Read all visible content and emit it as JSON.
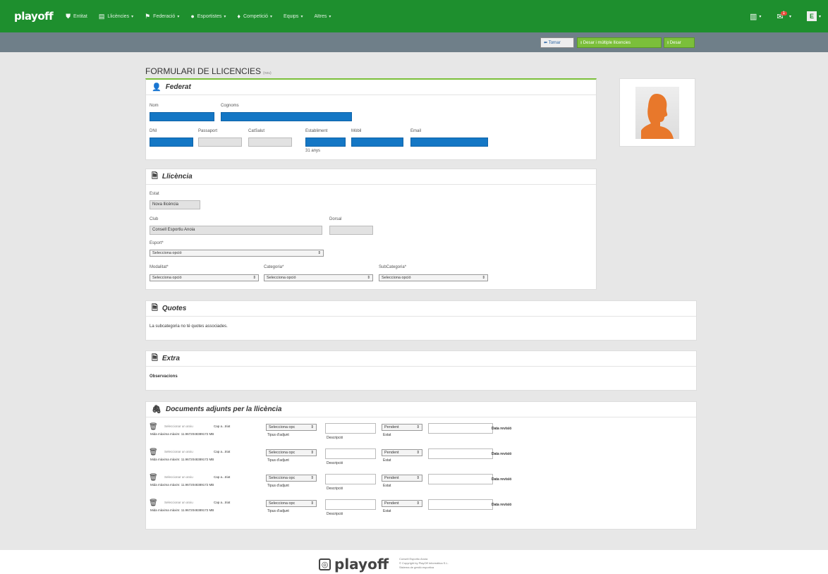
{
  "app": {
    "logo": "playoff"
  },
  "nav": {
    "items": [
      {
        "label": "Entitat",
        "icon": "shield-icon"
      },
      {
        "label": "Llicències",
        "icon": "id-card-icon"
      },
      {
        "label": "Federació",
        "icon": "flag-icon"
      },
      {
        "label": "Esportistes",
        "icon": "user-icon"
      },
      {
        "label": "Competició",
        "icon": "trophy-icon"
      },
      {
        "label": "Equips",
        "icon": ""
      },
      {
        "label": "Altres",
        "icon": ""
      }
    ],
    "right": {
      "stats_icon": "chart-icon",
      "notif_badge": "1",
      "avatar_letter": "E"
    }
  },
  "toolbar": {
    "back_label": "Tornar",
    "save_multi_label": "Desar i múltiple llicencies",
    "save_label": "Desar"
  },
  "page": {
    "title": "FORMULARI DE LLICENCIES",
    "title_small": "(nou)"
  },
  "federat": {
    "header": "Federat",
    "nom_label": "Nom",
    "cognoms_label": "Cognoms",
    "dni_label": "DNI",
    "passaport_label": "Passaport",
    "catsalut_label": "CatSalut",
    "naixement_label": "Establiment",
    "mobil_label": "Mòbil",
    "email_label": "Email",
    "age_note": "31 anys"
  },
  "llicencia": {
    "header": "Llicència",
    "estat_label": "Estat",
    "estat_value": "Nova llicència",
    "club_label": "Club",
    "club_value": "Consell Esportiu Anoia",
    "dorsal_label": "Dorsal",
    "esport_label": "Esport*",
    "esport_value": "Selecciona opció",
    "modalitat_label": "Modalitat*",
    "modalitat_value": "Selecciona opció",
    "categoria_label": "Categoria*",
    "categoria_value": "Selecciona opció",
    "subcategoria_label": "SubCategoria*",
    "subcategoria_value": "Selecciona opció"
  },
  "quotes": {
    "header": "Quotes",
    "message": "La subcategoria no té quotes associades."
  },
  "extra": {
    "header": "Extra",
    "observacions_label": "Observacions"
  },
  "documents": {
    "header": "Documents adjunts per la llicència",
    "rows": [
      {
        "file_btn": "Seleccionar un arxiu",
        "file_name": "Cap a...triat",
        "max_size": "Mida màxima màxim: 11.9672048389172 MB",
        "tipus_value": "Selecciona opc",
        "tipus_label": "Tipus d'adjunt",
        "desc_label": "Descripció",
        "estat_value": "Pendent",
        "estat_label": "Estat",
        "revisio_label": "Data revisió"
      },
      {
        "file_btn": "Seleccionar un arxiu",
        "file_name": "Cap a...triat",
        "max_size": "Mida màxima màxim: 11.9672048389172 MB",
        "tipus_value": "Selecciona opc",
        "tipus_label": "Tipus d'adjunt",
        "desc_label": "Descripció",
        "estat_value": "Pendent",
        "estat_label": "Estat",
        "revisio_label": "Data revisió"
      },
      {
        "file_btn": "Seleccionar un arxiu",
        "file_name": "Cap a...triat",
        "max_size": "Mida màxima màxim: 11.9672048389172 MB",
        "tipus_value": "Selecciona opc",
        "tipus_label": "Tipus d'adjunt",
        "desc_label": "Descripció",
        "estat_value": "Pendent",
        "estat_label": "Estat",
        "revisio_label": "Data revisió"
      },
      {
        "file_btn": "Seleccionar un arxiu",
        "file_name": "Cap a...triat",
        "max_size": "Mida màxima màxim: 11.9672048389172 MB",
        "tipus_value": "Selecciona opc",
        "tipus_label": "Tipus d'adjunt",
        "desc_label": "Descripció",
        "estat_value": "Pendent",
        "estat_label": "Estat",
        "revisio_label": "Data revisió"
      }
    ]
  },
  "footer": {
    "logo": "playoff",
    "line1": "Consell Esportiu Anoia",
    "line2": "© Copyright by PlayOff Informàtica S.L.",
    "line3": "Sistema de gestió esportiva"
  },
  "colors": {
    "nav_green": "#1e8f2e",
    "field_blue": "#1477c5",
    "save_green": "#7bbf3a"
  }
}
